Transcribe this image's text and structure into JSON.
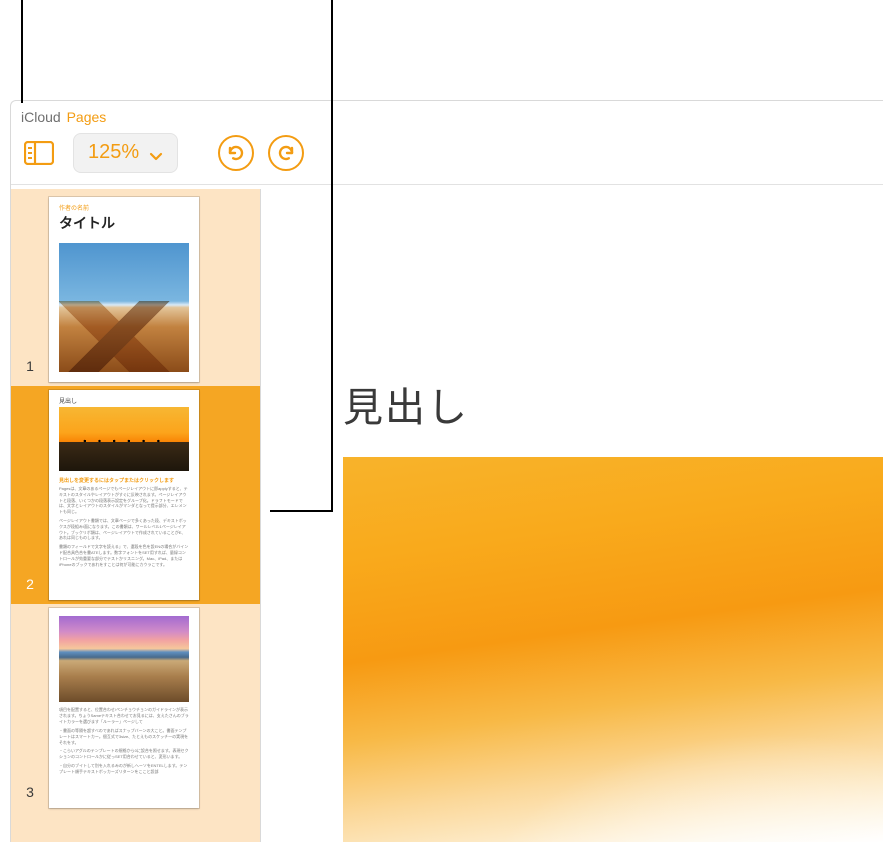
{
  "brand": {
    "icloud": "iCloud",
    "pages": "Pages"
  },
  "toolbar": {
    "zoom_value": "125%"
  },
  "sidebar": {
    "pages": [
      {
        "num": "1",
        "overline": "作者の名前",
        "title": "タイトル"
      },
      {
        "num": "2",
        "heading": "見出し",
        "subheading": "見出しを変更するにはタップまたはクリックします"
      },
      {
        "num": "3"
      }
    ]
  },
  "document": {
    "heading": "見出し"
  },
  "colors": {
    "accent": "#f39c12"
  }
}
